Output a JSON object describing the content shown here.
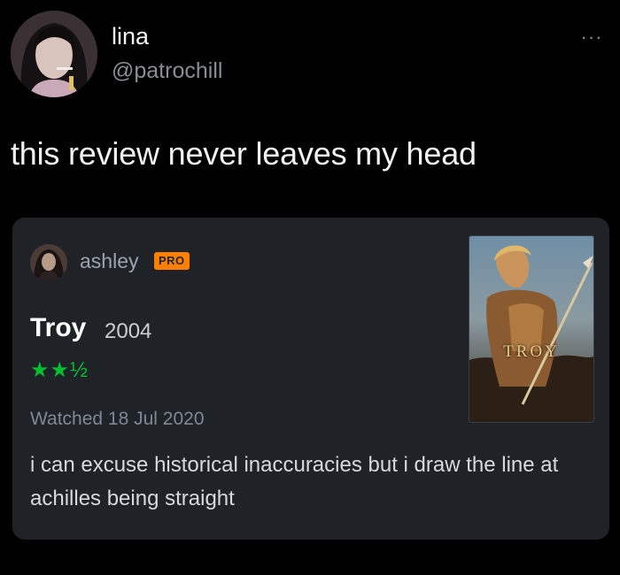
{
  "tweet": {
    "author_name": "lina",
    "author_handle": "@patrochill",
    "more_label": "···",
    "text": "this review never leaves my head"
  },
  "review_card": {
    "reviewer_name": "ashley",
    "badge": "PRO",
    "film_title": "Troy",
    "film_year": "2004",
    "rating": "★★½",
    "rating_value": 2.5,
    "watched": "Watched 18 Jul 2020",
    "review_text": "i can excuse historical inaccuracies but i draw the line at achilles being straight",
    "poster_title": "TROY"
  },
  "colors": {
    "background": "#000000",
    "card": "#1f2328",
    "rating_green": "#00c030",
    "pro_orange": "#ff8000",
    "secondary_text": "#8a8d91"
  }
}
